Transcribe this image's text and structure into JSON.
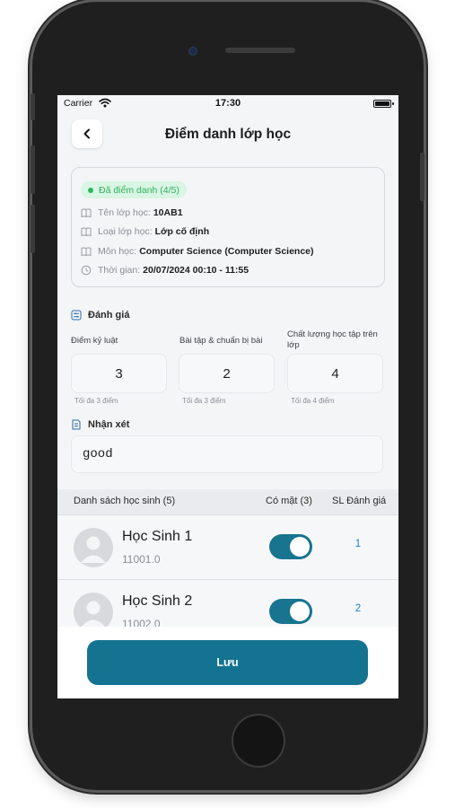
{
  "status_bar": {
    "carrier": "Carrier",
    "time": "17:30"
  },
  "header": {
    "title": "Điểm danh lớp học"
  },
  "class_info": {
    "status_badge": "Đã điểm danh (4/5)",
    "rows": [
      {
        "icon": "book-icon",
        "label": "Tên lớp học:",
        "value": "10AB1"
      },
      {
        "icon": "book-icon",
        "label": "Loại lớp học:",
        "value": "Lớp cố định"
      },
      {
        "icon": "book-icon",
        "label": "Môn học:",
        "value": "Computer Science (Computer Science)"
      },
      {
        "icon": "clock-icon",
        "label": "Thời gian:",
        "value": "20/07/2024 00:10 - 11:55"
      }
    ]
  },
  "evaluation": {
    "section_title": "Đánh giá",
    "criteria": [
      {
        "label": "Điểm kỷ luật",
        "score": "3",
        "max_note": "Tối đa 3 điểm"
      },
      {
        "label": "Bài tập & chuẩn bị bài",
        "score": "2",
        "max_note": "Tối đa 3 điểm"
      },
      {
        "label": "Chất lượng học tập trên lớp",
        "score": "4",
        "max_note": "Tối đa 4 điểm"
      }
    ]
  },
  "comment": {
    "section_title": "Nhận xét",
    "value": "good"
  },
  "student_list": {
    "header": {
      "title": "Danh sách học sinh (5)",
      "present_col": "Có mặt (3)",
      "eval_col": "SL Đánh giá"
    },
    "students": [
      {
        "name": "Học Sinh 1",
        "code": "11001.0",
        "present": true,
        "eval_count": "1"
      },
      {
        "name": "Học Sinh 2",
        "code": "11002.0",
        "present": true,
        "eval_count": "2"
      }
    ]
  },
  "footer": {
    "save_label": "Lưu"
  },
  "colors": {
    "primary": "#147391",
    "success": "#2fb35f",
    "link": "#1a7fd6"
  }
}
